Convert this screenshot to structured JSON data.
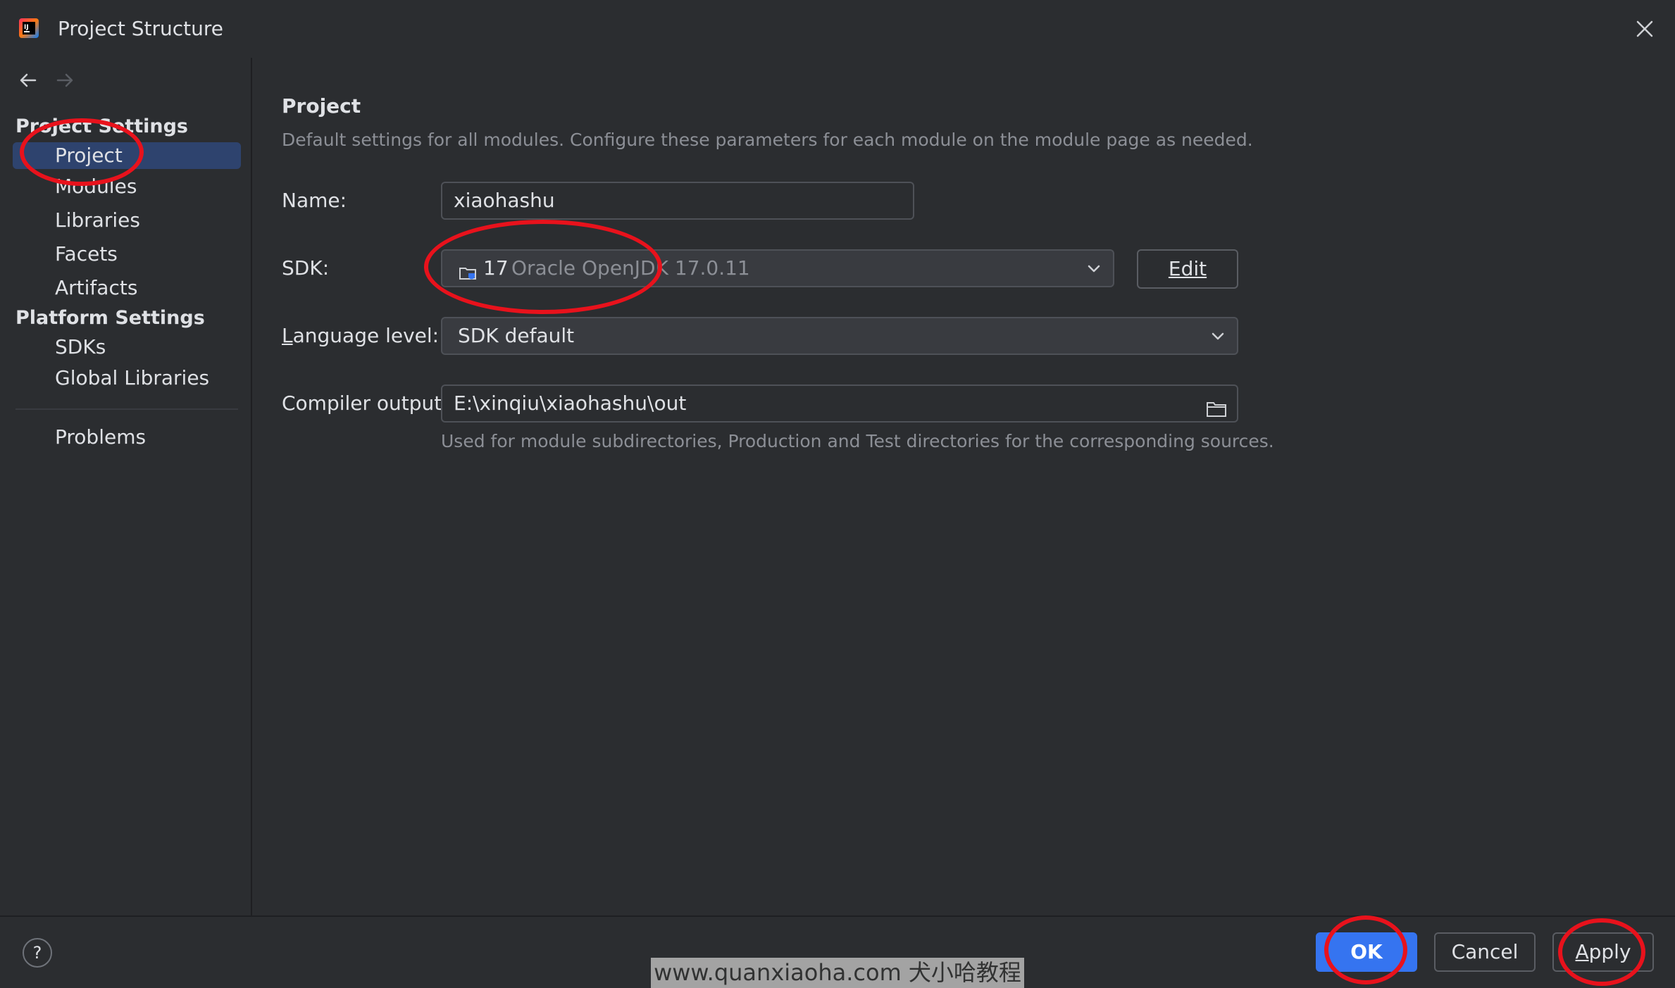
{
  "window": {
    "title": "Project Structure",
    "icon": "intellij-idea-icon"
  },
  "sidebar": {
    "project_settings_header": "Project Settings",
    "platform_settings_header": "Platform Settings",
    "items": [
      {
        "label": "Project",
        "selected": true
      },
      {
        "label": "Modules"
      },
      {
        "label": "Libraries"
      },
      {
        "label": "Facets"
      },
      {
        "label": "Artifacts"
      },
      {
        "label": "SDKs"
      },
      {
        "label": "Global Libraries"
      },
      {
        "label": "Problems"
      }
    ]
  },
  "main": {
    "title": "Project",
    "description": "Default settings for all modules. Configure these parameters for each module on the module page as needed.",
    "name_label": "Name:",
    "name_value": "xiaohashu",
    "sdk_label": "SDK:",
    "sdk_version": "17",
    "sdk_name": "Oracle OpenJDK 17.0.11",
    "edit_button": "Edit",
    "language_level_label_first": "L",
    "language_level_label_rest": "anguage level:",
    "language_level_value": "SDK default",
    "compiler_output_label": "Compiler output:",
    "compiler_output_value": "E:\\xinqiu\\xiaohashu\\out",
    "compiler_output_hint": "Used for module subdirectories, Production and Test directories for the corresponding sources."
  },
  "footer": {
    "help": "?",
    "ok_button": "OK",
    "cancel_button": "Cancel",
    "apply_button_first": "A",
    "apply_button_rest": "pply",
    "watermark": "www.quanxiaoha.com 犬小哈教程"
  },
  "colors": {
    "background": "#2b2d30",
    "selection": "#2e436e",
    "accent": "#3574f0",
    "annotation": "#e8121c"
  }
}
